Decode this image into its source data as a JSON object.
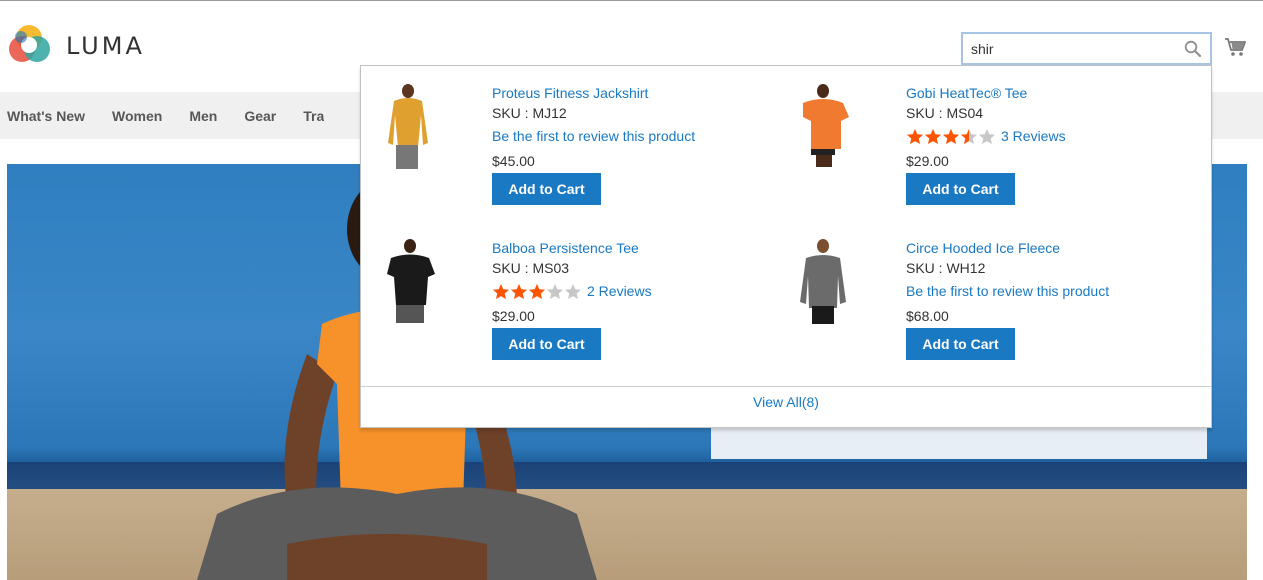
{
  "header": {
    "logo_text": "LUMA",
    "search_value": "shir"
  },
  "nav": {
    "items": [
      "What's New",
      "Women",
      "Men",
      "Gear",
      "Training"
    ]
  },
  "autocomplete": {
    "products": [
      {
        "name": "Proteus Fitness Jackshirt",
        "sku": "SKU : MJ12",
        "review_text": "Be the first to review this product",
        "rating": null,
        "reviews": "",
        "price": "$45.00",
        "add_label": "Add to Cart",
        "shirt_color": "#e0a030"
      },
      {
        "name": "Gobi HeatTec® Tee",
        "sku": "SKU : MS04",
        "review_text": "",
        "rating": 3.5,
        "reviews": "3 Reviews",
        "price": "$29.00",
        "add_label": "Add to Cart",
        "shirt_color": "#f07a30"
      },
      {
        "name": "Balboa Persistence Tee",
        "sku": "SKU : MS03",
        "review_text": "",
        "rating": 3,
        "reviews": "2 Reviews",
        "price": "$29.00",
        "add_label": "Add to Cart",
        "shirt_color": "#1a1a1a"
      },
      {
        "name": "Circe Hooded Ice Fleece",
        "sku": "SKU : WH12",
        "review_text": "Be the first to review this product",
        "rating": null,
        "reviews": "",
        "price": "$68.00",
        "add_label": "Add to Cart",
        "shirt_color": "#6b6b6b"
      }
    ],
    "view_all": "View All(8)"
  },
  "colors": {
    "link": "#1979c3",
    "star_on": "#ff5501",
    "star_off": "#c7c7c7"
  }
}
